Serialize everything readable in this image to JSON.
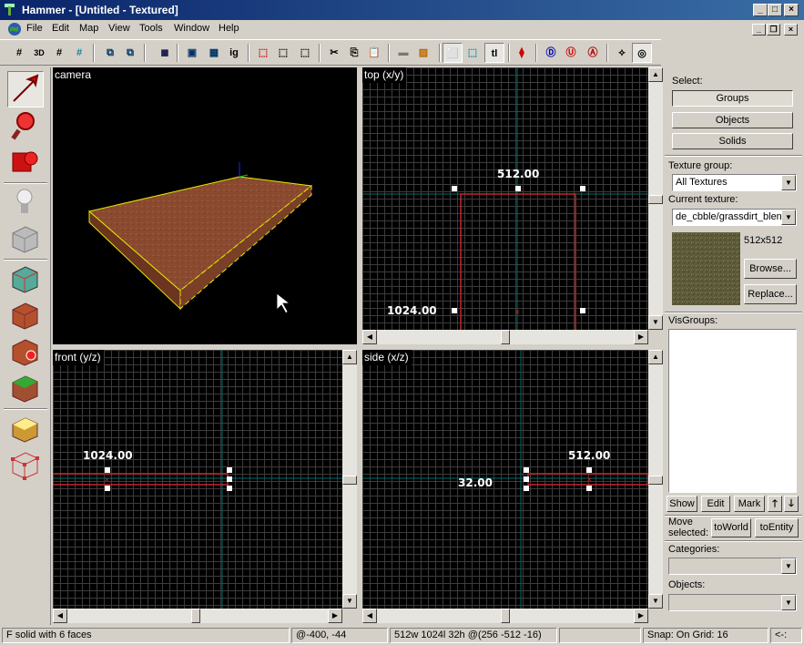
{
  "window": {
    "title": "Hammer - [Untitled - Textured]"
  },
  "menu": [
    "File",
    "Edit",
    "Map",
    "View",
    "Tools",
    "Window",
    "Help"
  ],
  "toolbar": {
    "ig_label": "ig",
    "tl_label": "tl",
    "threed_label": "3D"
  },
  "palette": [
    "selection-tool",
    "magnify-tool",
    "camera-tool",
    "entity-tool",
    "block-tool",
    "texture-application-tool",
    "apply-current-texture-tool",
    "decal-tool",
    "overlay-tool",
    "clipping-tool",
    "vertex-tool"
  ],
  "viewports": {
    "camera": {
      "label": "camera"
    },
    "top": {
      "label": "top (x/y)",
      "width_label": "512.00",
      "height_label": "1024.00"
    },
    "front": {
      "label": "front (y/z)",
      "width_label": "1024.00"
    },
    "side": {
      "label": "side (x/z)",
      "width_label": "512.00",
      "height_label": "32.00"
    }
  },
  "panel": {
    "select_label": "Select:",
    "select_buttons": [
      "Groups",
      "Objects",
      "Solids"
    ],
    "texture_group_label": "Texture group:",
    "texture_group_value": "All Textures",
    "current_texture_label": "Current texture:",
    "current_texture_value": "de_cbble/grassdirt_blend",
    "texture_size": "512x512",
    "browse_label": "Browse...",
    "replace_label": "Replace...",
    "visgroups_label": "VisGroups:",
    "vis_buttons": [
      "Show",
      "Edit",
      "Mark"
    ],
    "move_selected_label": "Move selected:",
    "to_world_label": "toWorld",
    "to_entity_label": "toEntity",
    "categories_label": "Categories:",
    "objects_label": "Objects:"
  },
  "status": {
    "hint": "F",
    "selection": "solid with 6 faces",
    "cursor_coords": "@-400, -44",
    "dimensions": "512w 1024l 32h @(256 -512 -16)",
    "snap": "Snap: On Grid: 16",
    "extra": "<-:"
  },
  "colors": {
    "titlebar": "#0a246a",
    "selection_red": "#c0272d",
    "bbox_yellow": "#e6e600",
    "grid": "#3c3c3c",
    "axis_teal": "#006c6c"
  }
}
